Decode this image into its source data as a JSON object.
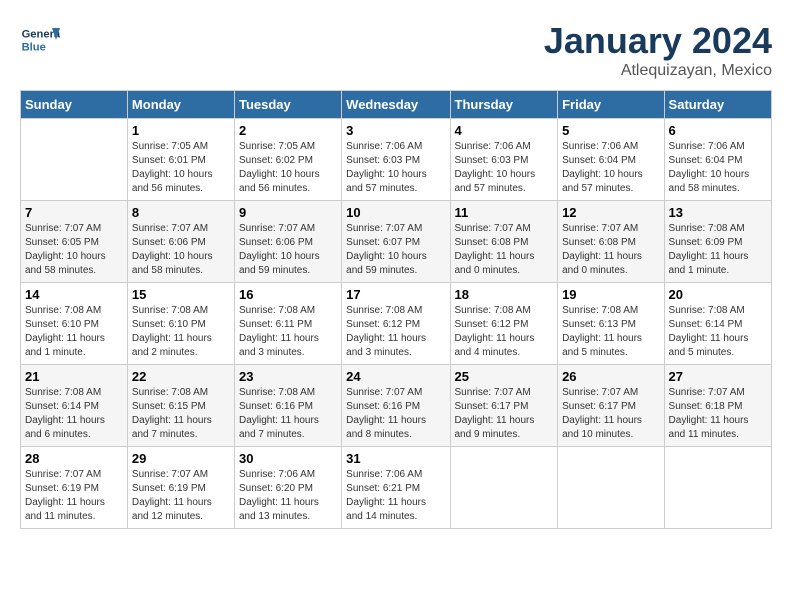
{
  "header": {
    "logo_line1": "General",
    "logo_line2": "Blue",
    "month": "January 2024",
    "location": "Atlequizayan, Mexico"
  },
  "weekdays": [
    "Sunday",
    "Monday",
    "Tuesday",
    "Wednesday",
    "Thursday",
    "Friday",
    "Saturday"
  ],
  "weeks": [
    [
      {
        "day": "",
        "info": ""
      },
      {
        "day": "1",
        "info": "Sunrise: 7:05 AM\nSunset: 6:01 PM\nDaylight: 10 hours\nand 56 minutes."
      },
      {
        "day": "2",
        "info": "Sunrise: 7:05 AM\nSunset: 6:02 PM\nDaylight: 10 hours\nand 56 minutes."
      },
      {
        "day": "3",
        "info": "Sunrise: 7:06 AM\nSunset: 6:03 PM\nDaylight: 10 hours\nand 57 minutes."
      },
      {
        "day": "4",
        "info": "Sunrise: 7:06 AM\nSunset: 6:03 PM\nDaylight: 10 hours\nand 57 minutes."
      },
      {
        "day": "5",
        "info": "Sunrise: 7:06 AM\nSunset: 6:04 PM\nDaylight: 10 hours\nand 57 minutes."
      },
      {
        "day": "6",
        "info": "Sunrise: 7:06 AM\nSunset: 6:04 PM\nDaylight: 10 hours\nand 58 minutes."
      }
    ],
    [
      {
        "day": "7",
        "info": "Sunrise: 7:07 AM\nSunset: 6:05 PM\nDaylight: 10 hours\nand 58 minutes."
      },
      {
        "day": "8",
        "info": "Sunrise: 7:07 AM\nSunset: 6:06 PM\nDaylight: 10 hours\nand 58 minutes."
      },
      {
        "day": "9",
        "info": "Sunrise: 7:07 AM\nSunset: 6:06 PM\nDaylight: 10 hours\nand 59 minutes."
      },
      {
        "day": "10",
        "info": "Sunrise: 7:07 AM\nSunset: 6:07 PM\nDaylight: 10 hours\nand 59 minutes."
      },
      {
        "day": "11",
        "info": "Sunrise: 7:07 AM\nSunset: 6:08 PM\nDaylight: 11 hours\nand 0 minutes."
      },
      {
        "day": "12",
        "info": "Sunrise: 7:07 AM\nSunset: 6:08 PM\nDaylight: 11 hours\nand 0 minutes."
      },
      {
        "day": "13",
        "info": "Sunrise: 7:08 AM\nSunset: 6:09 PM\nDaylight: 11 hours\nand 1 minute."
      }
    ],
    [
      {
        "day": "14",
        "info": "Sunrise: 7:08 AM\nSunset: 6:10 PM\nDaylight: 11 hours\nand 1 minute."
      },
      {
        "day": "15",
        "info": "Sunrise: 7:08 AM\nSunset: 6:10 PM\nDaylight: 11 hours\nand 2 minutes."
      },
      {
        "day": "16",
        "info": "Sunrise: 7:08 AM\nSunset: 6:11 PM\nDaylight: 11 hours\nand 3 minutes."
      },
      {
        "day": "17",
        "info": "Sunrise: 7:08 AM\nSunset: 6:12 PM\nDaylight: 11 hours\nand 3 minutes."
      },
      {
        "day": "18",
        "info": "Sunrise: 7:08 AM\nSunset: 6:12 PM\nDaylight: 11 hours\nand 4 minutes."
      },
      {
        "day": "19",
        "info": "Sunrise: 7:08 AM\nSunset: 6:13 PM\nDaylight: 11 hours\nand 5 minutes."
      },
      {
        "day": "20",
        "info": "Sunrise: 7:08 AM\nSunset: 6:14 PM\nDaylight: 11 hours\nand 5 minutes."
      }
    ],
    [
      {
        "day": "21",
        "info": "Sunrise: 7:08 AM\nSunset: 6:14 PM\nDaylight: 11 hours\nand 6 minutes."
      },
      {
        "day": "22",
        "info": "Sunrise: 7:08 AM\nSunset: 6:15 PM\nDaylight: 11 hours\nand 7 minutes."
      },
      {
        "day": "23",
        "info": "Sunrise: 7:08 AM\nSunset: 6:16 PM\nDaylight: 11 hours\nand 7 minutes."
      },
      {
        "day": "24",
        "info": "Sunrise: 7:07 AM\nSunset: 6:16 PM\nDaylight: 11 hours\nand 8 minutes."
      },
      {
        "day": "25",
        "info": "Sunrise: 7:07 AM\nSunset: 6:17 PM\nDaylight: 11 hours\nand 9 minutes."
      },
      {
        "day": "26",
        "info": "Sunrise: 7:07 AM\nSunset: 6:17 PM\nDaylight: 11 hours\nand 10 minutes."
      },
      {
        "day": "27",
        "info": "Sunrise: 7:07 AM\nSunset: 6:18 PM\nDaylight: 11 hours\nand 11 minutes."
      }
    ],
    [
      {
        "day": "28",
        "info": "Sunrise: 7:07 AM\nSunset: 6:19 PM\nDaylight: 11 hours\nand 11 minutes."
      },
      {
        "day": "29",
        "info": "Sunrise: 7:07 AM\nSunset: 6:19 PM\nDaylight: 11 hours\nand 12 minutes."
      },
      {
        "day": "30",
        "info": "Sunrise: 7:06 AM\nSunset: 6:20 PM\nDaylight: 11 hours\nand 13 minutes."
      },
      {
        "day": "31",
        "info": "Sunrise: 7:06 AM\nSunset: 6:21 PM\nDaylight: 11 hours\nand 14 minutes."
      },
      {
        "day": "",
        "info": ""
      },
      {
        "day": "",
        "info": ""
      },
      {
        "day": "",
        "info": ""
      }
    ]
  ]
}
